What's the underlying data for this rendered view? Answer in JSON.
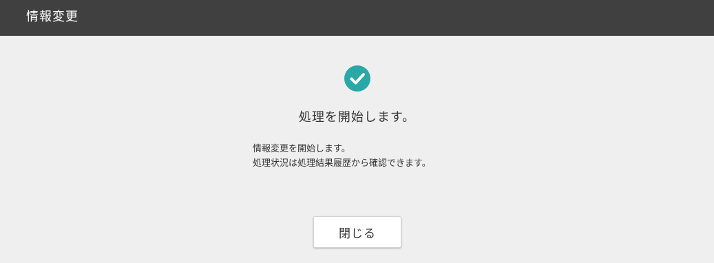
{
  "titlebar": {
    "title": "情報変更"
  },
  "status": {
    "icon": "check-circle-icon",
    "accent_color": "#2aa8a8",
    "heading": "処理を開始します。"
  },
  "message": {
    "lines": [
      "情報変更を開始します。",
      "処理状況は処理結果履歴から確認できます。"
    ]
  },
  "actions": {
    "close_label": "閉じる"
  }
}
